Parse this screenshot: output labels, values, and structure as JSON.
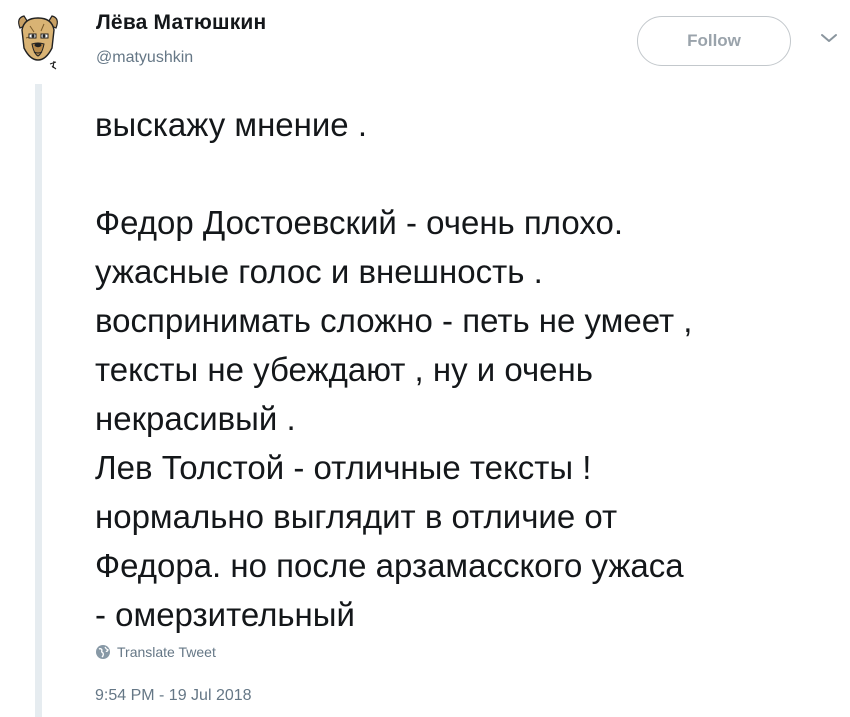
{
  "author": {
    "name": "Лёва Матюшкин",
    "handle": "@matyushkin",
    "avatar_icon": "dog-portrait-icon"
  },
  "header": {
    "follow_label": "Follow",
    "menu_icon": "chevron-down-icon"
  },
  "tweet": {
    "text": "выскажу мнение .\n\nФедор Достоевский - очень плохо.\nужасные голос и внешность .\nвоспринимать сложно - петь не умеет ,\nтексты не убеждают , ну и очень\nнекрасивый .\nЛев Толстой - отличные тексты !\nнормально выглядит в отличие от\nФедора. но после арзамасского ужаса\n- омерзительный",
    "translate_label": "Translate Tweet",
    "translate_icon": "globe-icon",
    "timestamp": "9:54 PM - 19 Jul 2018"
  },
  "colors": {
    "text": "#14171a",
    "secondary": "#657786",
    "follow_text": "#9aa3ab",
    "follow_border": "#c3c8cc",
    "thread_line": "#e6ecf0"
  }
}
